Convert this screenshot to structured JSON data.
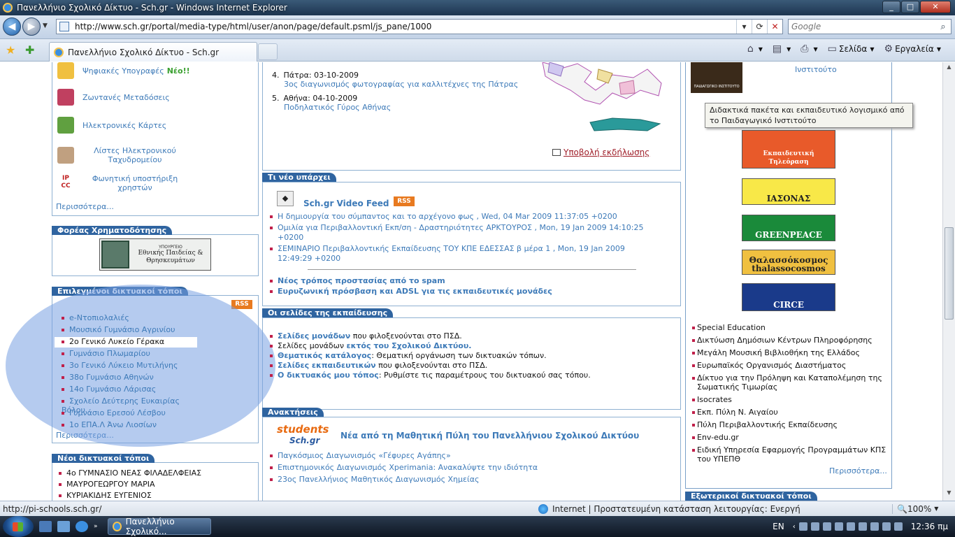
{
  "window": {
    "title": "Πανελλήνιο Σχολικό Δίκτυο - Sch.gr - Windows Internet Explorer"
  },
  "address": {
    "url": "http://www.sch.gr/portal/media-type/html/user/anon/page/default.psml/js_pane/1000",
    "search_placeholder": "Google"
  },
  "tabs": {
    "active": "Πανελλήνιο Σχολικό Δίκτυο - Sch.gr"
  },
  "commandbar": {
    "page": "Σελίδα",
    "tools": "Εργαλεία"
  },
  "left": {
    "services": [
      {
        "label": "Ψηφιακές Υπογραφές",
        "badge": "Νέο!!",
        "icon": "medal-icon"
      },
      {
        "label": "Ζωντανές Μεταδόσεις",
        "icon": "camera-icon"
      },
      {
        "label": "Ηλεκτρονικές Κάρτες",
        "icon": "card-icon"
      },
      {
        "label": "Λίστες Ηλεκτρονικού Ταχυδρομείου",
        "icon": "mail-list-icon"
      },
      {
        "label": "Φωνητική υποστήριξη χρηστών",
        "icon": "ipcc-icon",
        "icon_text": "IP CC"
      }
    ],
    "services_more": "Περισσότερα...",
    "funding": {
      "head": "Φορέας Χρηματοδότησης",
      "logo_small": "ΥΠΟΥΡΓΕΙΟ",
      "logo_main": "Εθνικής Παιδείας & Θρησκευμάτων"
    },
    "featured": {
      "head": "Επιλεγμένοι δικτυακοί τόποι",
      "rss": "RSS",
      "items": [
        "e-Ντοπιολαλιές",
        "Μουσικό Γυμνάσιο Αγρινίου",
        "2ο Γενικό Λυκείο Γέρακα",
        "Γυμνάσιο Πλωμαρίου",
        "3ο Γενικό Λύκειο Μυτιλήνης",
        "38ο Γυμνάσιο Αθηνών",
        "14ο Γυμνάσιο Λάρισας",
        "Σχολείο Δεύτερης Ευκαιρίας Βόλου",
        "Γυμνάσιο Ερεσού Λέσβου",
        "1ο ΕΠΑ.Λ Άνω Λιοσίων"
      ],
      "more": "Περισσότερα..."
    },
    "newsites": {
      "head": "Νέοι δικτυακοί τόποι",
      "items": [
        "4ο ΓΥΜΝΑΣΙΟ ΝΕΑΣ ΦΙΛΑΔΕΛΦΕΙΑΣ",
        "ΜΑΥΡΟΓΕΩΡΓΟΥ ΜΑΡΙΑ",
        "ΚΥΡΙΑΚΙΔΗΣ ΕΥΓΕΝΙΟΣ"
      ]
    }
  },
  "center": {
    "events": [
      {
        "num": "4.",
        "title": "Πάτρα: 03-10-2009",
        "desc": "3ος διαγωνισμός φωτογραφίας για καλλιτέχνες της Πάτρας"
      },
      {
        "num": "5.",
        "title": "Αθήνα: 04-10-2009",
        "desc": "Ποδηλατικός Γύρος Αθήνας"
      }
    ],
    "submit_event": "Υποβολή εκδήλωσης",
    "whatsnew": {
      "head": "Τι νέο υπάρχει",
      "feed_title": "Sch.gr Video Feed",
      "rss": "RSS",
      "items": [
        "Η δημιουργία του σύμπαντος και το αρχέγονο φως , Wed, 04 Mar 2009 11:37:05 +0200",
        "Ομιλία για Περιβαλλοντική Εκπ/ση - Δραστηριότητες ΑΡΚΤΟΥΡΟΣ , Mon, 19 Jan 2009 14:10:25 +0200",
        "ΣΕΜΙΝΑΡΙΟ Περιβαλλοντικής Εκπαίδευσης ΤΟΥ ΚΠΕ ΕΔΕΣΣΑΣ β      μέρα 1 , Mon, 19 Jan 2009 12:49:29 +0200"
      ],
      "bold_links": [
        "Νέος τρόπος προστασίας από το spam",
        "Ευρυζωνική πρόσβαση και ADSL για τις εκπαιδευτικές μονάδες"
      ]
    },
    "edupages": {
      "head": "Οι σελίδες της εκπαίδευσης",
      "rows": [
        {
          "link": "Σελίδες μονάδων",
          "rest": " που φιλοξενούνται στο ΠΣΔ."
        },
        {
          "pre": "Σελίδες μονάδων ",
          "link": "εκτός του Σχολικού Δικτύου.",
          "rest": ""
        },
        {
          "link": "Θεματικός κατάλογος",
          "rest": ": Θεματική οργάνωση των δικτυακών τόπων."
        },
        {
          "link": "Σελίδες εκπαιδευτικών",
          "rest": " που φιλοξενούνται στο ΠΣΔ."
        },
        {
          "link": "Ο δικτυακός μου τόπος",
          "rest": ": Ρυθμίστε τις παραμέτρους του δικτυακού σας τόπου."
        }
      ]
    },
    "announcements": {
      "head": "Ανακτήσεις",
      "logo_top": "students",
      "logo_bottom": "Sch.gr",
      "title": "Νέα από τη Μαθητική Πύλη του Πανελλήνιου Σχολικού Δικτύου",
      "items": [
        "Παγκόσμιος Διαγωνισμός «Γέφυρες Αγάπης»",
        "Επιστημονικός Διαγωνισμός Xperimania: Ανακαλύψτε την ιδιότητα",
        "23ος Πανελλήνιος Μαθητικός Διαγωνισμός Χημείας"
      ]
    }
  },
  "right": {
    "pi_caption": "Ινστιτούτο",
    "pi_logo": "ΠΑΙΔΑΓΩΓΙΚΟ ΙΝΣΤΙΤΟΥΤΟ",
    "tooltip": "Διδακτικά πακέτα και  εκπαιδευτικό λογισμικό από το Παιδαγωγικό Ινστιτούτο",
    "banners": [
      {
        "text": "Εκπαιδευτική Τηλεόραση",
        "bg": "#e85a2a"
      },
      {
        "text": "ΙΑΣΟΝΑΣ",
        "bg": "#f8e848"
      },
      {
        "text": "GREENPEACE",
        "bg": "#1a8a3a"
      },
      {
        "text": "Θαλασσόκοσμος thalassocosmos",
        "bg": "#f0c040"
      },
      {
        "text": "CIRCE",
        "bg": "#1a3a8a"
      }
    ],
    "links": [
      "Special Education",
      "Δικτύωση Δημόσιων Κέντρων Πληροφόρησης",
      "Μεγάλη Μουσική Βιβλιοθήκη της Ελλάδος",
      "Ευρωπαϊκός Οργανισμός Διαστήματος",
      "Δίκτυο για την Πρόληψη και Καταπολέμηση της Σωματικής Τιμωρίας",
      "Isocrates",
      "Εκπ. Πύλη Ν. Αιγαίου",
      "Πύλη Περιβαλλοντικής Εκπαίδευσης",
      "Env-edu.gr",
      "Ειδική Υπηρεσία Εφαρμογής Προγραμμάτων ΚΠΣ του ΥΠΕΠΘ"
    ],
    "more": "Περισσότερα...",
    "external_head": "Εξωτερικοί δικτυακοί τόποι"
  },
  "status": {
    "url": "http://pi-schools.sch.gr/",
    "zone": "Internet | Προστατευμένη κατάσταση λειτουργίας: Ενεργή",
    "zoom": "100%"
  },
  "taskbar": {
    "task": "Πανελλήνιο Σχολικό...",
    "lang": "EN",
    "time": "12:36 πμ"
  }
}
